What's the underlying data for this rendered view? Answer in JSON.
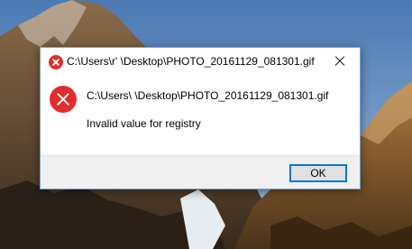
{
  "dialog": {
    "title": "C:\\Users\\r'     \\Desktop\\PHOTO_20161129_081301.gif",
    "path_line": "C:\\Users\\        \\Desktop\\PHOTO_20161129_081301.gif",
    "message": "Invalid value for registry",
    "ok_label": "OK",
    "error_icon": "error-x-icon",
    "close_icon": "close-icon"
  },
  "colors": {
    "error_red": "#e22d2d",
    "focus_blue": "#0078d7",
    "footer_gray": "#f0f0f0"
  }
}
